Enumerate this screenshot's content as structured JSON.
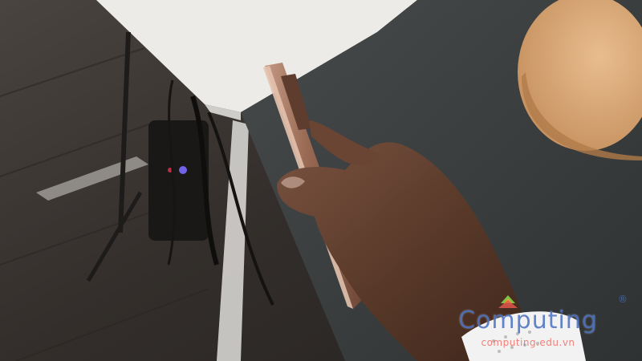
{
  "scene": {
    "description_alt": "Hand holding a bronze smartphone sideways over a dark desk",
    "colors": {
      "floor": "#3b3633",
      "desk_top": "#3c3f40",
      "white_desk": "#ecebe8",
      "phone_body": "#9a6b55",
      "skin": "#5a3a2a",
      "wood_board": "#d9a877",
      "strap": "#f2f2f2"
    }
  },
  "watermark": {
    "brand": "Computing",
    "registered": "®",
    "url": "computing.edu.vn",
    "icon": "logo-icon"
  }
}
